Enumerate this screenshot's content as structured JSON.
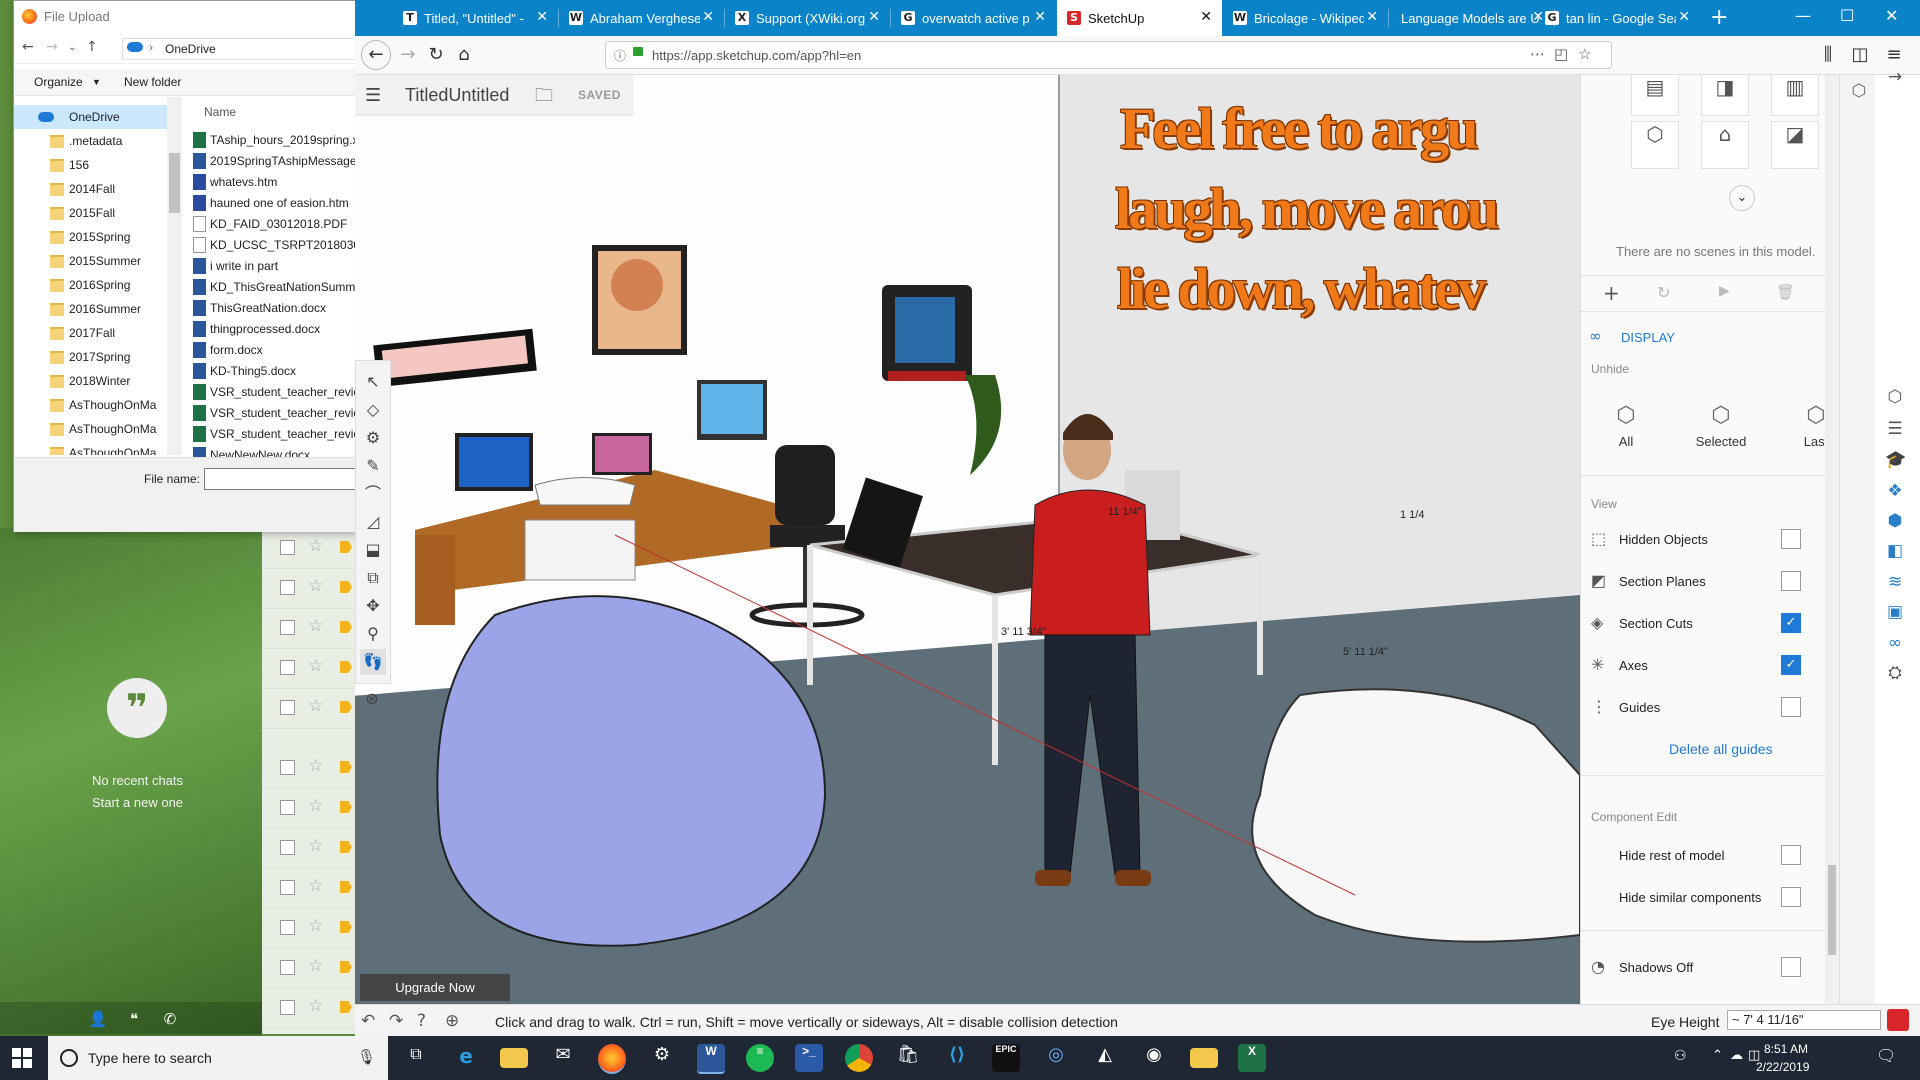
{
  "file_dialog": {
    "title": "File Upload",
    "path": "OneDrive",
    "toolbar": {
      "organize": "Organize",
      "new_folder": "New folder"
    },
    "column_name": "Name",
    "nav_items": [
      {
        "label": "OneDrive",
        "selected": true
      },
      {
        "label": ".metadata"
      },
      {
        "label": "156"
      },
      {
        "label": "2014Fall"
      },
      {
        "label": "2015Fall"
      },
      {
        "label": "2015Spring"
      },
      {
        "label": "2015Summer"
      },
      {
        "label": "2016Spring"
      },
      {
        "label": "2016Summer"
      },
      {
        "label": "2017Fall"
      },
      {
        "label": "2017Spring"
      },
      {
        "label": "2018Winter"
      },
      {
        "label": "AsThoughOnMa"
      },
      {
        "label": "AsThoughOnMa"
      },
      {
        "label": "AsThoughOnMa"
      }
    ],
    "files": [
      {
        "name": "TAship_hours_2019spring.x",
        "type": "x"
      },
      {
        "name": "2019SpringTAshipMessage",
        "type": "w"
      },
      {
        "name": "whatevs.htm",
        "type": "h"
      },
      {
        "name": "hauned one of easion.htm",
        "type": "h"
      },
      {
        "name": "KD_FAID_03012018.PDF",
        "type": "p"
      },
      {
        "name": "KD_UCSC_TSRPT20180301.p",
        "type": "p"
      },
      {
        "name": "i write               in part",
        "type": "w"
      },
      {
        "name": "KD_ThisGreatNationSumm",
        "type": "w"
      },
      {
        "name": "ThisGreatNation.docx",
        "type": "w"
      },
      {
        "name": "thingprocessed.docx",
        "type": "w"
      },
      {
        "name": "form.docx",
        "type": "w"
      },
      {
        "name": "KD-Thing5.docx",
        "type": "w"
      },
      {
        "name": "VSR_student_teacher_revie",
        "type": "x"
      },
      {
        "name": "VSR_student_teacher_revie",
        "type": "x"
      },
      {
        "name": "VSR_student_teacher_revie",
        "type": "x"
      },
      {
        "name": "NewNewNew.docx",
        "type": "w"
      }
    ],
    "file_name_label": "File name:",
    "file_name_value": ""
  },
  "hangouts": {
    "line1": "No recent chats",
    "line2": "Start a new one"
  },
  "browser": {
    "tabs": [
      {
        "label": "Titled, \"Untitled\" - ",
        "fav": "T"
      },
      {
        "label": "Abraham Verghese",
        "fav": "W"
      },
      {
        "label": "Support (XWiki.org)",
        "fav": "X"
      },
      {
        "label": "overwatch active p",
        "fav": "G"
      },
      {
        "label": "SketchUp",
        "fav": "S",
        "active": true
      },
      {
        "label": "Bricolage - Wikiped",
        "fav": "W"
      },
      {
        "label": "Language Models are U",
        "fav": ""
      },
      {
        "label": "tan lin - Google Sea",
        "fav": "G"
      }
    ],
    "url": "https://app.sketchup.com/app?hl=en"
  },
  "sketchup": {
    "title": "TitledUntitled",
    "saved": "SAVED",
    "wordart": [
      "Feel free to argu",
      "laugh, move arou",
      "lie down, whatev"
    ],
    "upgrade": "Upgrade Now",
    "status": "Click and drag to walk. Ctrl = run, Shift = move vertically or sideways, Alt = disable collision detection",
    "eye_height_label": "Eye Height",
    "eye_height_value": "~ 7' 4 11/16\"",
    "dims": [
      "11 1/4\"",
      "1 1/4",
      "3' 11 3/4\"",
      "5' 11 1/4\""
    ]
  },
  "panel": {
    "no_scenes": "There are no scenes in this model.",
    "display_title": "DISPLAY",
    "unhide_header": "Unhide",
    "unhide": [
      "All",
      "Selected",
      "Last"
    ],
    "view_header": "View",
    "view_items": [
      {
        "label": "Hidden Objects",
        "checked": false
      },
      {
        "label": "Section Planes",
        "checked": false
      },
      {
        "label": "Section Cuts",
        "checked": true
      },
      {
        "label": "Axes",
        "checked": true
      },
      {
        "label": "Guides",
        "checked": false
      }
    ],
    "delete_guides": "Delete all guides",
    "component_header": "Component Edit",
    "component_items": [
      {
        "label": "Hide rest of model",
        "checked": false
      },
      {
        "label": "Hide similar components",
        "checked": false
      }
    ],
    "shadows": {
      "label": "Shadows Off",
      "checked": false
    }
  },
  "taskbar": {
    "search_placeholder": "Type here to search",
    "time": "8:51 AM",
    "date": "2/22/2019"
  },
  "colors": {
    "accent": "#1e7ad6",
    "tabbar": "#0b83c9",
    "sketchup_red": "#d9262a",
    "wordart": "#f07a1a"
  }
}
